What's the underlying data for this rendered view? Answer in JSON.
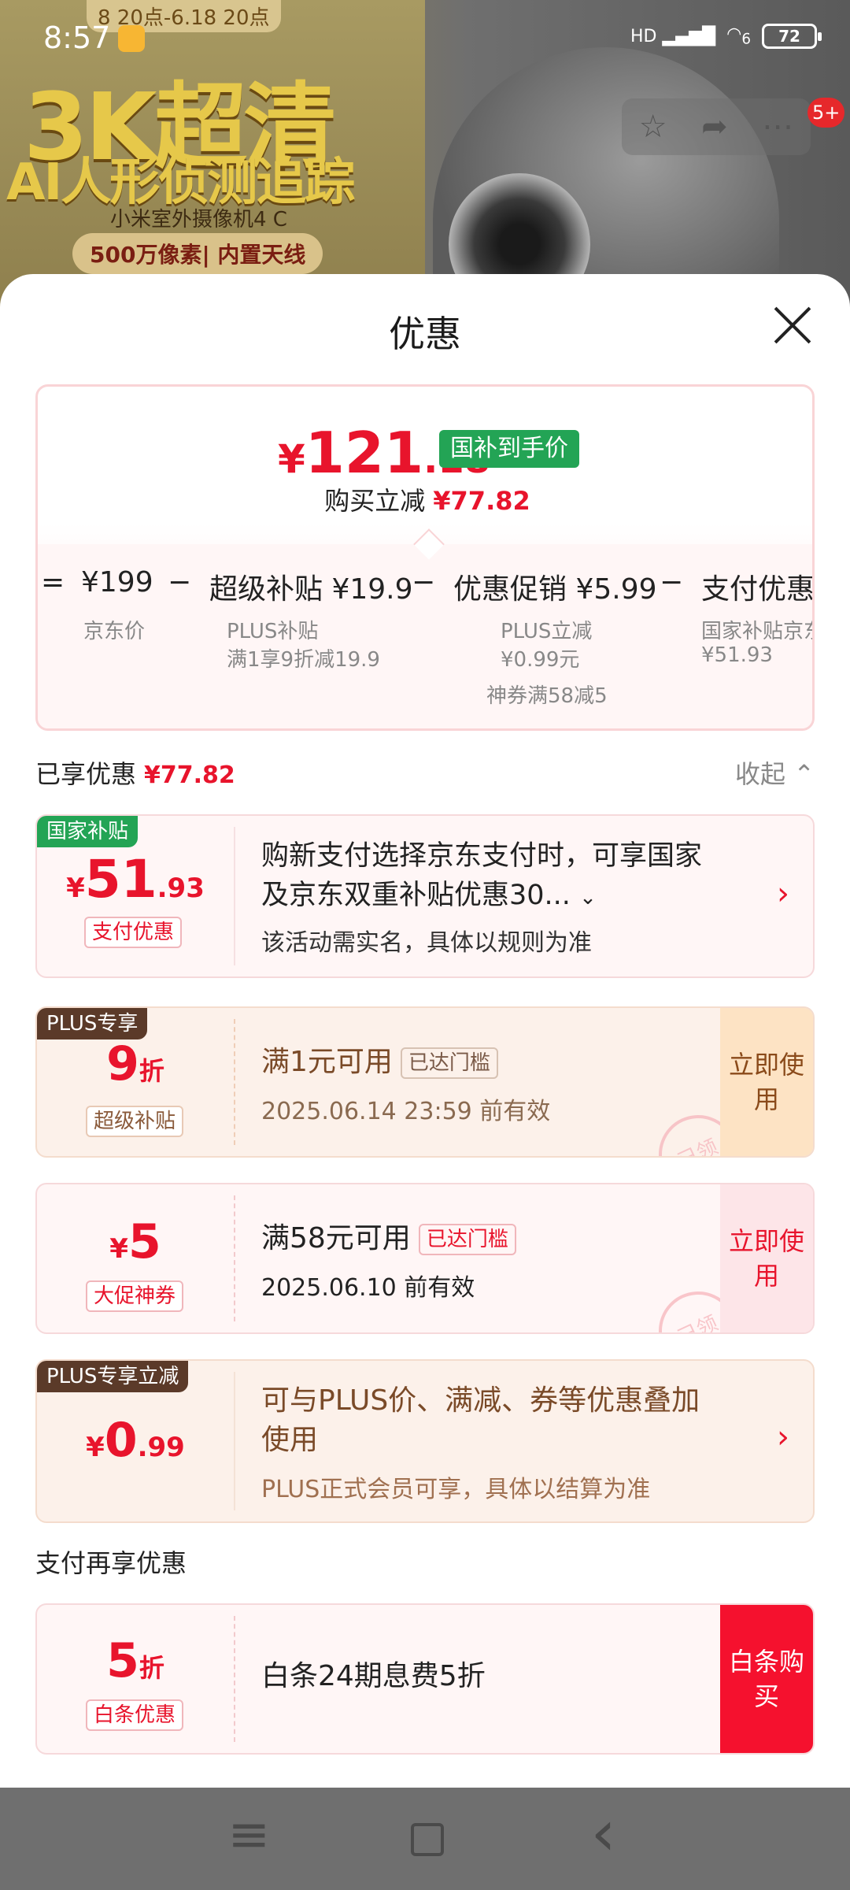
{
  "status_bar": {
    "time": "8:57",
    "network": "HD",
    "wifi_index": "6",
    "battery": "72"
  },
  "banner": {
    "date_range": "8 20点-6.18 20点",
    "headline": "3K超清",
    "subline": "AI人形侦测追踪",
    "model": "小米室外摄像机4 C",
    "badge": "500万像素| 内置天线",
    "notification_count": "5+"
  },
  "sheet": {
    "title": "优惠",
    "summary": {
      "currency": "¥",
      "price_int": "121",
      "price_dec": ".18",
      "gov_tag": "国补到手价",
      "instant_label": "购买立减",
      "instant_amount": "¥77.82",
      "breakdown": [
        {
          "op": "=",
          "value": "",
          "sub": []
        },
        {
          "op": "",
          "value": "¥199",
          "sub": [
            "京东价"
          ]
        },
        {
          "op": "−",
          "value": "超级补贴 ¥19.9",
          "sub": [
            "PLUS补贴",
            "满1享9折减19.9"
          ]
        },
        {
          "op": "−",
          "value": "优惠促销 ¥5.99",
          "sub": [
            "PLUS立减",
            "¥0.99元",
            "神券满58减5"
          ]
        },
        {
          "op": "−",
          "value": "支付优惠 ¥",
          "sub": [
            "国家补贴京东",
            "¥51.93"
          ]
        }
      ]
    },
    "enjoyed_label": "已享优惠",
    "enjoyed_amount": "¥77.82",
    "collapse_label": "收起",
    "cards": [
      {
        "corner": "国家补贴",
        "cur": "¥",
        "big": "51",
        "small": ".93",
        "chip": "支付优惠",
        "main_line1": "购新支付选择京东支付时，可享国家",
        "main_line2": "及京东双重补贴优惠30...",
        "sub": "该活动需实名，具体以规则为准"
      },
      {
        "corner": "PLUS专享",
        "big": "9",
        "unit": "折",
        "chip": "超级补贴",
        "main": "满1元可用",
        "tag": "已达门槛",
        "sub": "2025.06.14 23:59 前有效",
        "button": "立即使用",
        "stamp": "已领"
      },
      {
        "cur": "¥",
        "big": "5",
        "chip": "大促神券",
        "main": "满58元可用",
        "tag": "已达门槛",
        "sub": "2025.06.10 前有效",
        "button": "立即使用",
        "stamp": "已领"
      },
      {
        "corner": "PLUS专享立减",
        "cur": "¥",
        "big": "0",
        "small": ".99",
        "main_line1": "可与PLUS价、满减、券等优惠叠加",
        "main_line2": "使用",
        "sub": "PLUS正式会员可享，具体以结算为准"
      }
    ],
    "pay_section_label": "支付再享优惠",
    "pay_card": {
      "big": "5",
      "unit": "折",
      "chip": "白条优惠",
      "main": "白条24期息费5折",
      "button": "白条购买"
    }
  },
  "colors": {
    "accent": "#e8142c",
    "gov_green": "#23a455",
    "plus_brown": "#5b3a29"
  }
}
